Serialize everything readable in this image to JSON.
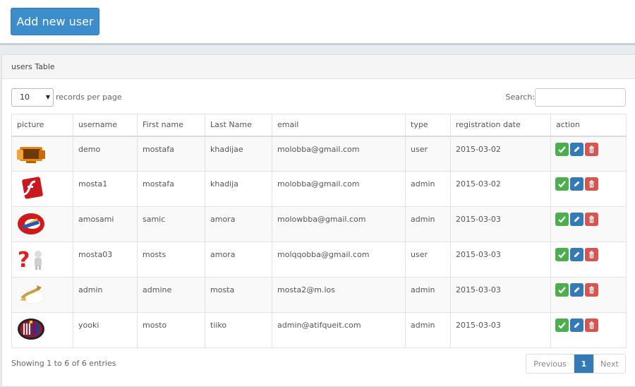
{
  "toolbar": {
    "add_user_label": "Add new user"
  },
  "panel": {
    "title": "users Table"
  },
  "controls": {
    "page_length_value": "10",
    "records_label": "records per page",
    "search_label": "Search:",
    "search_value": ""
  },
  "table": {
    "headers": [
      "picture",
      "username",
      "First name",
      "Last Name",
      "email",
      "type",
      "registration date",
      "action"
    ],
    "rows": [
      {
        "picture": "devices-icon",
        "username": "demo",
        "first_name": "mostafa",
        "last_name": "khadijae",
        "email": "molobba@gmail.com",
        "type": "user",
        "registration_date": "2015-03-02"
      },
      {
        "picture": "flash-icon",
        "username": "mosta1",
        "first_name": "mostafa",
        "last_name": "khadija",
        "email": "molobba@gmail.com",
        "type": "admin",
        "registration_date": "2015-03-02"
      },
      {
        "picture": "red-disc-icon",
        "username": "amosami",
        "first_name": "samic",
        "last_name": "amora",
        "email": "molowbba@gmail.com",
        "type": "admin",
        "registration_date": "2015-03-03"
      },
      {
        "picture": "question-person-icon",
        "username": "mosta03",
        "first_name": "mosts",
        "last_name": "amora",
        "email": "molqqobba@gmail.com",
        "type": "user",
        "registration_date": "2015-03-03"
      },
      {
        "picture": "gold-arrow-icon",
        "username": "admin",
        "first_name": "admine",
        "last_name": "mosta",
        "email": "mosta2@m.los",
        "type": "admin",
        "registration_date": "2015-03-03"
      },
      {
        "picture": "crest-badge-icon",
        "username": "yooki",
        "first_name": "mosto",
        "last_name": "tiiko",
        "email": "admin@atifqueit.com",
        "type": "admin",
        "registration_date": "2015-03-03"
      }
    ]
  },
  "footer": {
    "info": "Showing 1 to 6 of 6 entries",
    "previous_label": "Previous",
    "current_page": "1",
    "next_label": "Next"
  },
  "colors": {
    "primary": "#3c8dcc",
    "success": "#4cae4c",
    "info": "#337ab7",
    "danger": "#d9534f"
  }
}
